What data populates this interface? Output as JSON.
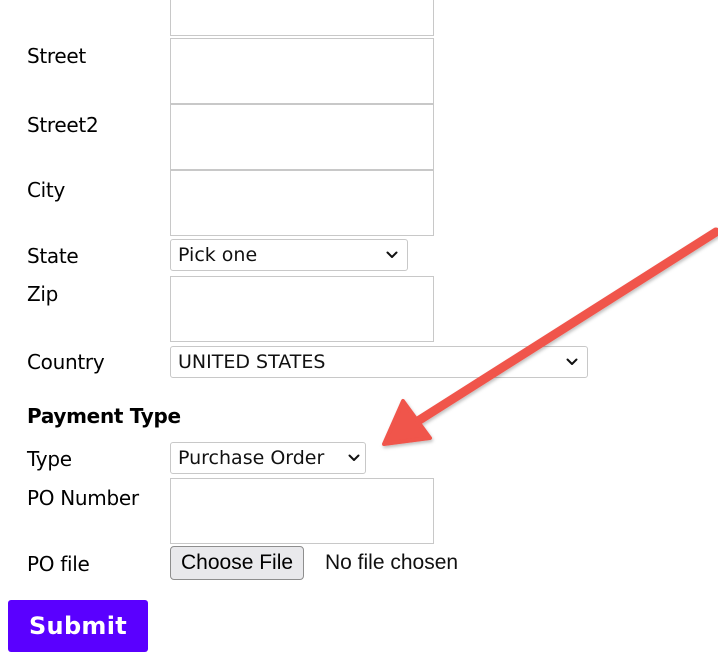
{
  "form": {
    "street_label": "Street",
    "street2_label": "Street2",
    "city_label": "City",
    "state_label": "State",
    "state_value": "Pick one",
    "zip_label": "Zip",
    "country_label": "Country",
    "country_value": "UNITED STATES"
  },
  "payment": {
    "heading": "Payment Type",
    "type_label": "Type",
    "type_value": "Purchase Order",
    "po_number_label": "PO Number",
    "po_file_label": "PO file",
    "file_button": "Choose File",
    "file_status": "No file chosen"
  },
  "actions": {
    "submit_label": "Submit"
  },
  "colors": {
    "submit_bg": "#5a00ff",
    "annotation_arrow": "#f0544b"
  },
  "icons": {
    "select_chevron": "chevron-down-icon",
    "annotation": "red-arrow-annotation"
  }
}
